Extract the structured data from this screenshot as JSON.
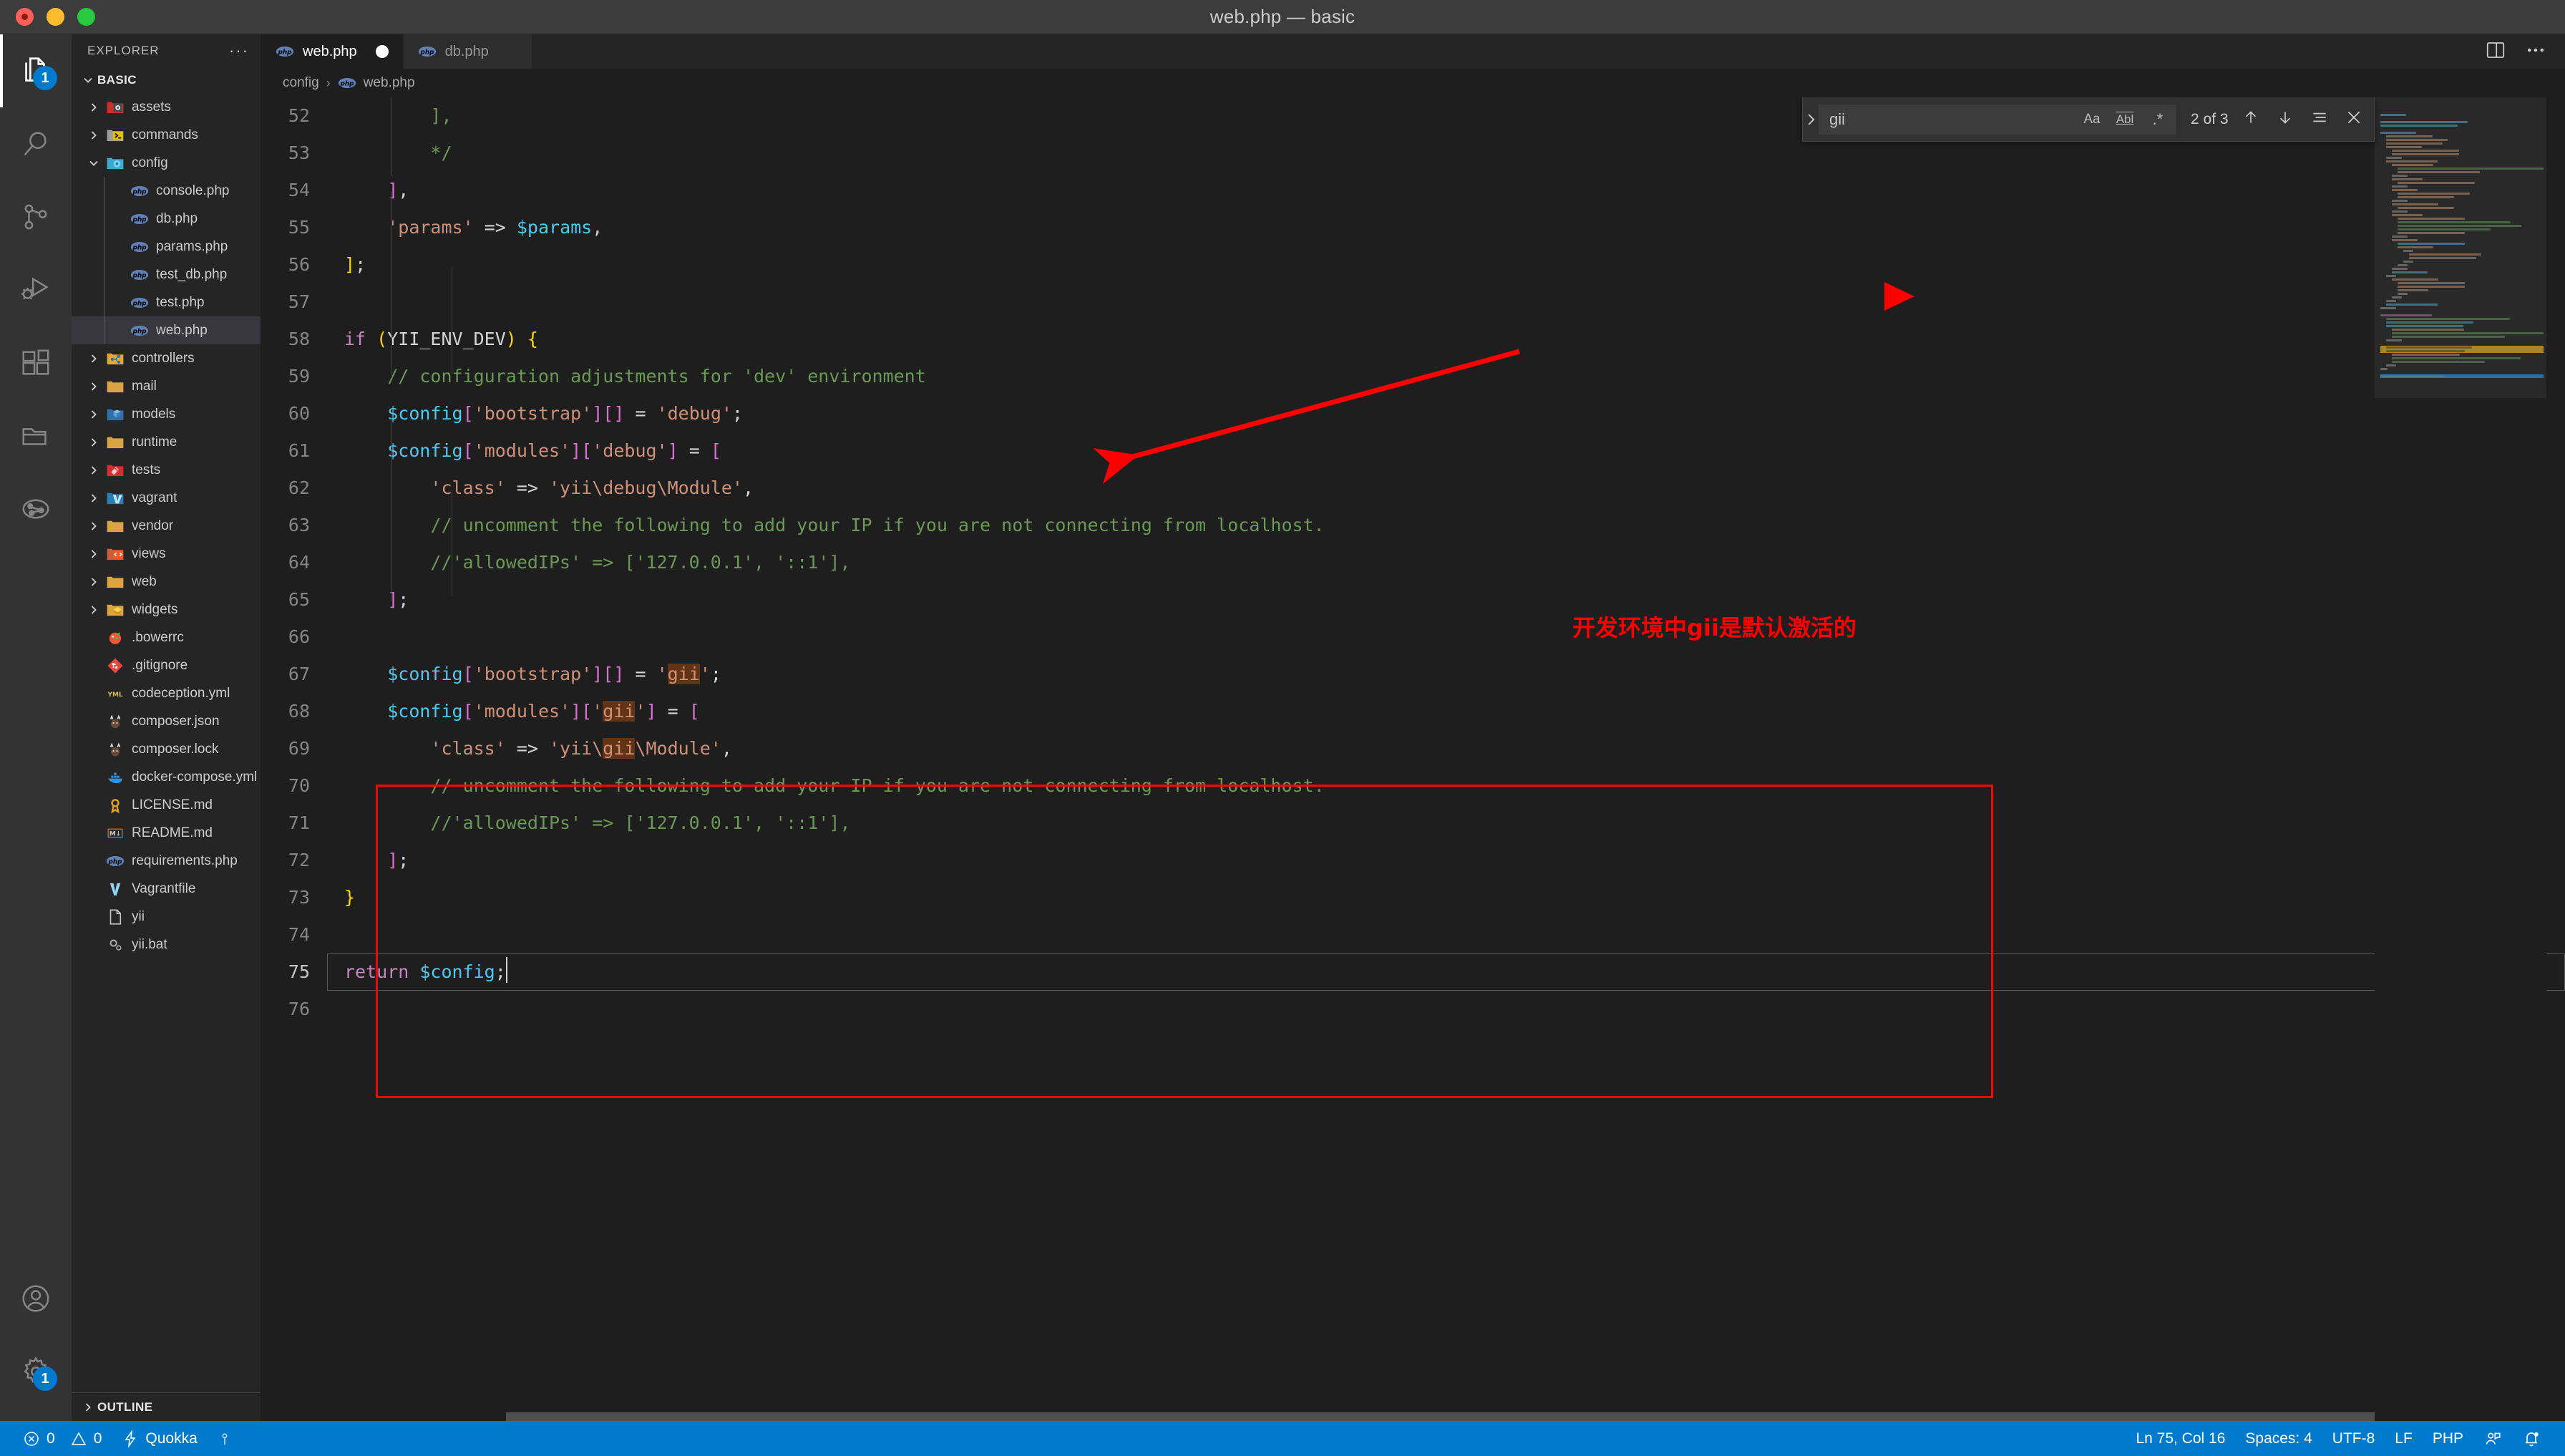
{
  "window": {
    "title": "web.php — basic",
    "traffic_lights": [
      "close",
      "minimize",
      "zoom"
    ]
  },
  "activity_bar": {
    "items": [
      {
        "name": "explorer",
        "icon": "files-icon",
        "badge": "1",
        "active": true
      },
      {
        "name": "search",
        "icon": "search-icon",
        "badge": "",
        "active": false
      },
      {
        "name": "source-control",
        "icon": "source-control-icon",
        "badge": "",
        "active": false
      },
      {
        "name": "run-and-debug",
        "icon": "run-debug-icon",
        "badge": "",
        "active": false
      },
      {
        "name": "extensions",
        "icon": "extensions-icon",
        "badge": "",
        "active": false
      },
      {
        "name": "remote-explorer",
        "icon": "folder-icon",
        "badge": "",
        "active": false
      },
      {
        "name": "git-graph",
        "icon": "git-graph-icon",
        "badge": "",
        "active": false
      }
    ],
    "bottom_items": [
      {
        "name": "accounts",
        "icon": "account-icon",
        "badge": ""
      },
      {
        "name": "manage-settings",
        "icon": "gear-icon",
        "badge": "1"
      }
    ]
  },
  "sidebar": {
    "header": "EXPLORER",
    "more_actions": "···",
    "root_folder": "BASIC",
    "outline_label": "OUTLINE",
    "tree": [
      {
        "label": "assets",
        "type": "folder",
        "depth": 1,
        "expanded": false,
        "icon": "folder-assets-icon",
        "selected": false
      },
      {
        "label": "commands",
        "type": "folder",
        "depth": 1,
        "expanded": false,
        "icon": "folder-command-icon",
        "selected": false
      },
      {
        "label": "config",
        "type": "folder",
        "depth": 1,
        "expanded": true,
        "icon": "folder-config-icon",
        "selected": false
      },
      {
        "label": "console.php",
        "type": "file",
        "depth": 2,
        "icon": "php-icon",
        "selected": false
      },
      {
        "label": "db.php",
        "type": "file",
        "depth": 2,
        "icon": "php-icon",
        "selected": false
      },
      {
        "label": "params.php",
        "type": "file",
        "depth": 2,
        "icon": "php-icon",
        "selected": false
      },
      {
        "label": "test_db.php",
        "type": "file",
        "depth": 2,
        "icon": "php-icon",
        "selected": false
      },
      {
        "label": "test.php",
        "type": "file",
        "depth": 2,
        "icon": "php-icon",
        "selected": false
      },
      {
        "label": "web.php",
        "type": "file",
        "depth": 2,
        "icon": "php-icon",
        "selected": true
      },
      {
        "label": "controllers",
        "type": "folder",
        "depth": 1,
        "expanded": false,
        "icon": "folder-controller-icon",
        "selected": false
      },
      {
        "label": "mail",
        "type": "folder",
        "depth": 1,
        "expanded": false,
        "icon": "folder-plain-icon",
        "selected": false
      },
      {
        "label": "models",
        "type": "folder",
        "depth": 1,
        "expanded": false,
        "icon": "folder-models-icon",
        "selected": false
      },
      {
        "label": "runtime",
        "type": "folder",
        "depth": 1,
        "expanded": false,
        "icon": "folder-plain-icon",
        "selected": false
      },
      {
        "label": "tests",
        "type": "folder",
        "depth": 1,
        "expanded": false,
        "icon": "folder-tests-icon",
        "selected": false
      },
      {
        "label": "vagrant",
        "type": "folder",
        "depth": 1,
        "expanded": false,
        "icon": "folder-vagrant-icon",
        "selected": false
      },
      {
        "label": "vendor",
        "type": "folder",
        "depth": 1,
        "expanded": false,
        "icon": "folder-plain-icon",
        "selected": false
      },
      {
        "label": "views",
        "type": "folder",
        "depth": 1,
        "expanded": false,
        "icon": "folder-views-icon",
        "selected": false
      },
      {
        "label": "web",
        "type": "folder",
        "depth": 1,
        "expanded": false,
        "icon": "folder-plain-icon",
        "selected": false
      },
      {
        "label": "widgets",
        "type": "folder",
        "depth": 1,
        "expanded": false,
        "icon": "folder-widgets-icon",
        "selected": false
      },
      {
        "label": ".bowerrc",
        "type": "file",
        "depth": 1,
        "icon": "bower-icon",
        "selected": false
      },
      {
        "label": ".gitignore",
        "type": "file",
        "depth": 1,
        "icon": "git-icon",
        "selected": false
      },
      {
        "label": "codeception.yml",
        "type": "file",
        "depth": 1,
        "icon": "yaml-icon",
        "selected": false
      },
      {
        "label": "composer.json",
        "type": "file",
        "depth": 1,
        "icon": "composer-icon",
        "selected": false
      },
      {
        "label": "composer.lock",
        "type": "file",
        "depth": 1,
        "icon": "composer-icon",
        "selected": false
      },
      {
        "label": "docker-compose.yml",
        "type": "file",
        "depth": 1,
        "icon": "docker-icon",
        "selected": false
      },
      {
        "label": "LICENSE.md",
        "type": "file",
        "depth": 1,
        "icon": "license-icon",
        "selected": false
      },
      {
        "label": "README.md",
        "type": "file",
        "depth": 1,
        "icon": "markdown-icon",
        "selected": false
      },
      {
        "label": "requirements.php",
        "type": "file",
        "depth": 1,
        "icon": "php-icon",
        "selected": false
      },
      {
        "label": "Vagrantfile",
        "type": "file",
        "depth": 1,
        "icon": "vagrant-icon",
        "selected": false
      },
      {
        "label": "yii",
        "type": "file",
        "depth": 1,
        "icon": "blank-file-icon",
        "selected": false
      },
      {
        "label": "yii.bat",
        "type": "file",
        "depth": 1,
        "icon": "settings-file-icon",
        "selected": false
      }
    ]
  },
  "editor": {
    "tabs": [
      {
        "label": "web.php",
        "icon": "php-icon",
        "active": true,
        "dirty": true
      },
      {
        "label": "db.php",
        "icon": "php-icon",
        "active": false,
        "dirty": false
      }
    ],
    "tab_actions": [
      {
        "name": "split-editor-button",
        "icon": "split-editor-icon"
      },
      {
        "name": "more-actions-button",
        "icon": "ellipsis-icon"
      }
    ],
    "breadcrumb": [
      "config",
      "web.php"
    ],
    "first_visible_line": 52,
    "lines": [
      {
        "n": 52,
        "tokens": [
          {
            "t": "        ",
            "c": "p"
          },
          {
            "t": "],",
            "c": "c"
          }
        ]
      },
      {
        "n": 53,
        "tokens": [
          {
            "t": "        ",
            "c": "p"
          },
          {
            "t": "*/",
            "c": "c"
          }
        ]
      },
      {
        "n": 54,
        "tokens": [
          {
            "t": "    ",
            "c": "p"
          },
          {
            "t": "]",
            "c": "br2"
          },
          {
            "t": ",",
            "c": "p"
          }
        ]
      },
      {
        "n": 55,
        "tokens": [
          {
            "t": "    ",
            "c": "p"
          },
          {
            "t": "'params'",
            "c": "s"
          },
          {
            "t": " => ",
            "c": "op"
          },
          {
            "t": "$params",
            "c": "v"
          },
          {
            "t": ",",
            "c": "p"
          }
        ]
      },
      {
        "n": 56,
        "tokens": [
          {
            "t": "]",
            "c": "br1"
          },
          {
            "t": ";",
            "c": "p"
          }
        ]
      },
      {
        "n": 57,
        "tokens": []
      },
      {
        "n": 58,
        "tokens": [
          {
            "t": "if ",
            "c": "k"
          },
          {
            "t": "(",
            "c": "br1"
          },
          {
            "t": "YII_ENV_DEV",
            "c": "p"
          },
          {
            "t": ")",
            "c": "br1"
          },
          {
            "t": " ",
            "c": "p"
          },
          {
            "t": "{",
            "c": "br1"
          }
        ]
      },
      {
        "n": 59,
        "tokens": [
          {
            "t": "    ",
            "c": "p"
          },
          {
            "t": "// configuration adjustments for 'dev' environment",
            "c": "c"
          }
        ]
      },
      {
        "n": 60,
        "tokens": [
          {
            "t": "    ",
            "c": "p"
          },
          {
            "t": "$config",
            "c": "v"
          },
          {
            "t": "[",
            "c": "br2"
          },
          {
            "t": "'bootstrap'",
            "c": "s"
          },
          {
            "t": "]",
            "c": "br2"
          },
          {
            "t": "[",
            "c": "br2"
          },
          {
            "t": "]",
            "c": "br2"
          },
          {
            "t": " = ",
            "c": "op"
          },
          {
            "t": "'debug'",
            "c": "s"
          },
          {
            "t": ";",
            "c": "p"
          }
        ]
      },
      {
        "n": 61,
        "tokens": [
          {
            "t": "    ",
            "c": "p"
          },
          {
            "t": "$config",
            "c": "v"
          },
          {
            "t": "[",
            "c": "br2"
          },
          {
            "t": "'modules'",
            "c": "s"
          },
          {
            "t": "]",
            "c": "br2"
          },
          {
            "t": "[",
            "c": "br2"
          },
          {
            "t": "'debug'",
            "c": "s"
          },
          {
            "t": "]",
            "c": "br2"
          },
          {
            "t": " = ",
            "c": "op"
          },
          {
            "t": "[",
            "c": "br2"
          }
        ]
      },
      {
        "n": 62,
        "tokens": [
          {
            "t": "        ",
            "c": "p"
          },
          {
            "t": "'class'",
            "c": "s"
          },
          {
            "t": " => ",
            "c": "op"
          },
          {
            "t": "'yii\\debug\\Module'",
            "c": "s"
          },
          {
            "t": ",",
            "c": "p"
          }
        ]
      },
      {
        "n": 63,
        "tokens": [
          {
            "t": "        ",
            "c": "p"
          },
          {
            "t": "// uncomment the following to add your IP if you are not connecting from localhost.",
            "c": "c"
          }
        ]
      },
      {
        "n": 64,
        "tokens": [
          {
            "t": "        ",
            "c": "p"
          },
          {
            "t": "//'allowedIPs' => ['127.0.0.1', '::1'],",
            "c": "c"
          }
        ]
      },
      {
        "n": 65,
        "tokens": [
          {
            "t": "    ",
            "c": "p"
          },
          {
            "t": "]",
            "c": "br2"
          },
          {
            "t": ";",
            "c": "p"
          }
        ]
      },
      {
        "n": 66,
        "tokens": []
      },
      {
        "n": 67,
        "tokens": [
          {
            "t": "    ",
            "c": "p"
          },
          {
            "t": "$config",
            "c": "v"
          },
          {
            "t": "[",
            "c": "br2"
          },
          {
            "t": "'bootstrap'",
            "c": "s"
          },
          {
            "t": "]",
            "c": "br2"
          },
          {
            "t": "[",
            "c": "br2"
          },
          {
            "t": "]",
            "c": "br2"
          },
          {
            "t": " = ",
            "c": "op"
          },
          {
            "t": "'",
            "c": "s"
          },
          {
            "t": "gii",
            "c": "s hl"
          },
          {
            "t": "'",
            "c": "s"
          },
          {
            "t": ";",
            "c": "p"
          }
        ]
      },
      {
        "n": 68,
        "tokens": [
          {
            "t": "    ",
            "c": "p"
          },
          {
            "t": "$config",
            "c": "v"
          },
          {
            "t": "[",
            "c": "br2"
          },
          {
            "t": "'modules'",
            "c": "s"
          },
          {
            "t": "]",
            "c": "br2"
          },
          {
            "t": "[",
            "c": "br2"
          },
          {
            "t": "'",
            "c": "s"
          },
          {
            "t": "gii",
            "c": "s hl"
          },
          {
            "t": "'",
            "c": "s"
          },
          {
            "t": "]",
            "c": "br2"
          },
          {
            "t": " = ",
            "c": "op"
          },
          {
            "t": "[",
            "c": "br2"
          }
        ]
      },
      {
        "n": 69,
        "tokens": [
          {
            "t": "        ",
            "c": "p"
          },
          {
            "t": "'class'",
            "c": "s"
          },
          {
            "t": " => ",
            "c": "op"
          },
          {
            "t": "'yii\\",
            "c": "s"
          },
          {
            "t": "gii",
            "c": "s hl"
          },
          {
            "t": "\\Module'",
            "c": "s"
          },
          {
            "t": ",",
            "c": "p"
          }
        ]
      },
      {
        "n": 70,
        "tokens": [
          {
            "t": "        ",
            "c": "p"
          },
          {
            "t": "// uncomment the following to add your IP if you are not connecting from localhost.",
            "c": "c"
          }
        ]
      },
      {
        "n": 71,
        "tokens": [
          {
            "t": "        ",
            "c": "p"
          },
          {
            "t": "//'allowedIPs' => ['127.0.0.1', '::1'],",
            "c": "c"
          }
        ]
      },
      {
        "n": 72,
        "tokens": [
          {
            "t": "    ",
            "c": "p"
          },
          {
            "t": "]",
            "c": "br2"
          },
          {
            "t": ";",
            "c": "p"
          }
        ]
      },
      {
        "n": 73,
        "tokens": [
          {
            "t": "}",
            "c": "br1"
          }
        ]
      },
      {
        "n": 74,
        "tokens": []
      },
      {
        "n": 75,
        "tokens": [
          {
            "t": "return ",
            "c": "k"
          },
          {
            "t": "$config",
            "c": "v"
          },
          {
            "t": ";",
            "c": "p"
          }
        ],
        "current": true
      },
      {
        "n": 76,
        "tokens": []
      }
    ]
  },
  "find_widget": {
    "expand_icon": "chevron-right-icon",
    "query": "gii",
    "placeholder": "Find",
    "options": [
      {
        "name": "match-case-toggle",
        "label": "Aa"
      },
      {
        "name": "match-whole-word-toggle",
        "label": "Abl"
      },
      {
        "name": "use-regex-toggle",
        "label": ".*"
      }
    ],
    "match_count": "2 of 3",
    "actions": [
      {
        "name": "previous-match-button",
        "icon": "arrow-up-icon"
      },
      {
        "name": "next-match-button",
        "icon": "arrow-down-icon"
      },
      {
        "name": "find-in-selection-button",
        "icon": "selection-icon"
      },
      {
        "name": "close-find-button",
        "icon": "close-icon"
      }
    ]
  },
  "annotations": {
    "chinese_note": "开发环境中gii是默认激活的",
    "note_color": "#ff0000",
    "highlight_box_color": "#ff0000",
    "arrow_color": "#ff0000",
    "arrow_target": "line 58 if (YII_ENV_DEV) {",
    "box_lines": "66-72"
  },
  "status_bar": {
    "left": [
      {
        "name": "problems",
        "icon": "error-icon",
        "text": "0"
      },
      {
        "name": "warnings",
        "icon": "warning-icon",
        "text": "0"
      },
      {
        "name": "quokka",
        "icon": "zap-icon",
        "text": "Quokka"
      },
      {
        "name": "quokka-extra",
        "icon": "bolt-icon",
        "text": ""
      }
    ],
    "right": [
      {
        "name": "editor-position",
        "text": "Ln 75, Col 16"
      },
      {
        "name": "editor-indentation",
        "text": "Spaces: 4"
      },
      {
        "name": "editor-encoding",
        "text": "UTF-8"
      },
      {
        "name": "editor-eol",
        "text": "LF"
      },
      {
        "name": "editor-language",
        "text": "PHP"
      },
      {
        "name": "feedback",
        "icon": "feedback-icon",
        "text": ""
      },
      {
        "name": "notifications",
        "icon": "bell-icon",
        "text": ""
      }
    ]
  },
  "colors": {
    "accent": "#007acc",
    "titlebar_bg": "#3c3c3c",
    "sidebar_bg": "#252526",
    "editor_bg": "#1e1e1e",
    "activitybar_bg": "#333333",
    "selection_bg": "#37373d",
    "find_match_bg": "#623315"
  }
}
